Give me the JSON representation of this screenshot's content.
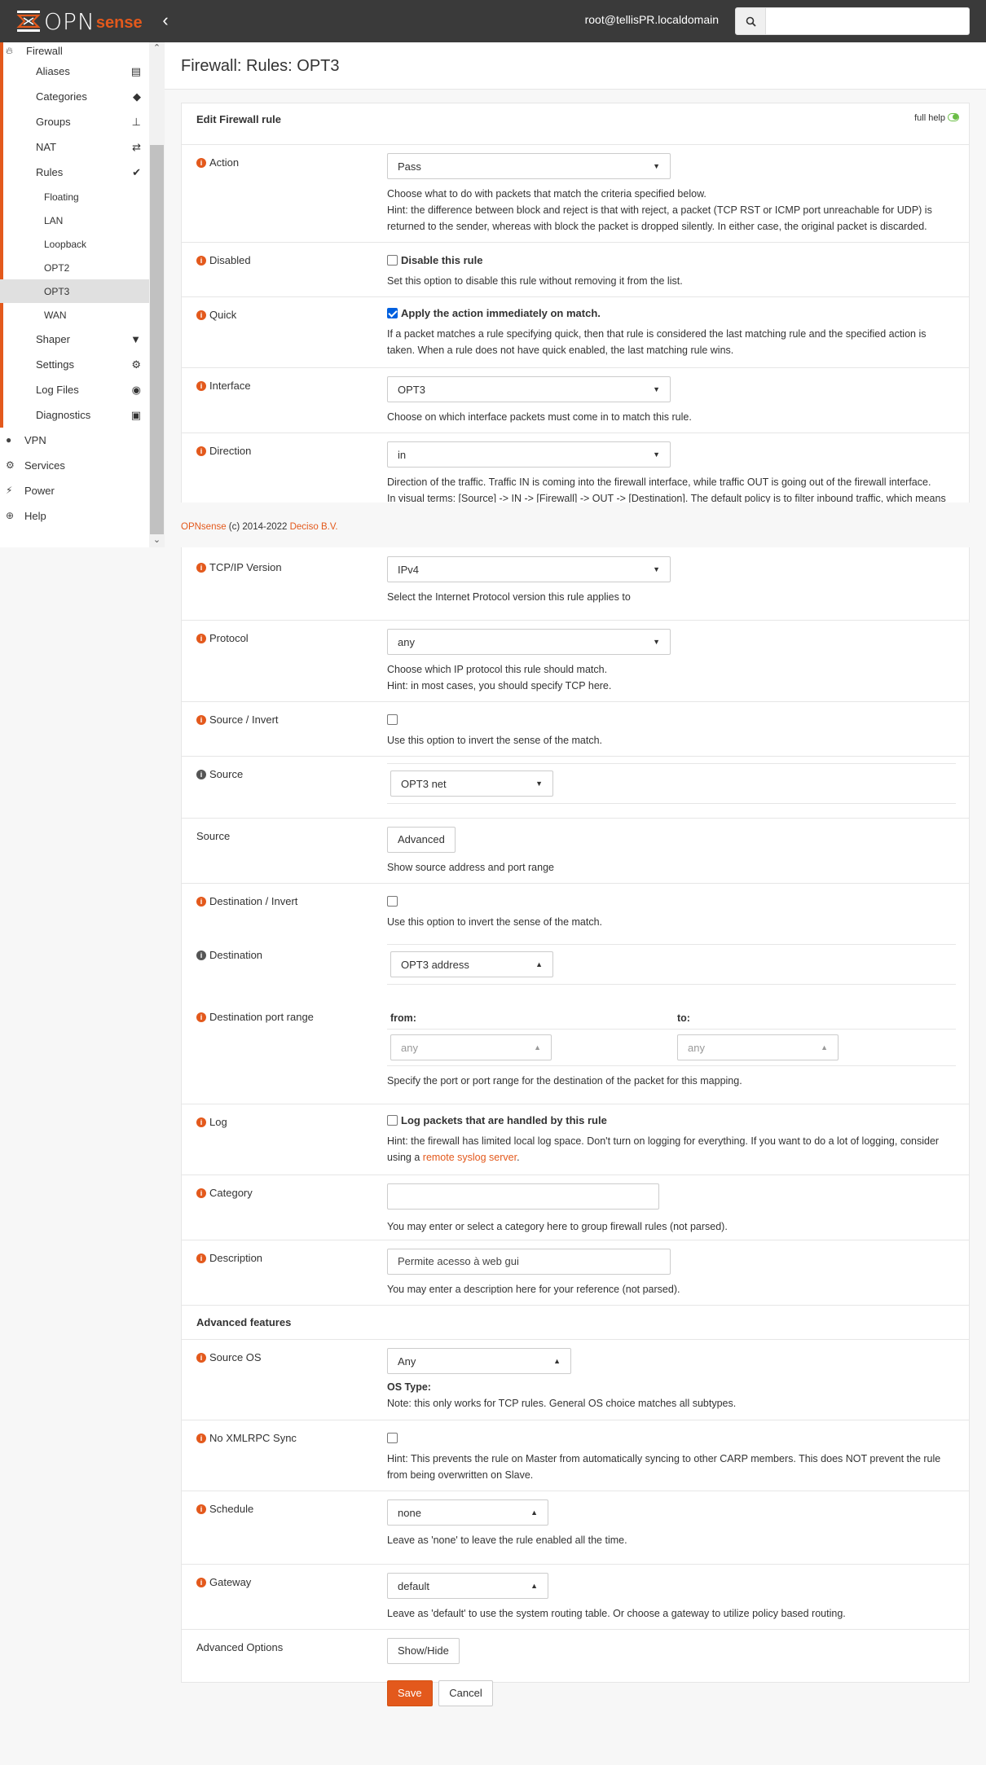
{
  "header": {
    "logo_text": "OPN",
    "logo_accent": "sense",
    "user": "root@tellisPR.localdomain",
    "search_placeholder": ""
  },
  "sidebar": {
    "firewall": "Firewall",
    "aliases": "Aliases",
    "categories": "Categories",
    "groups": "Groups",
    "nat": "NAT",
    "rules": "Rules",
    "rule_floating": "Floating",
    "rule_lan": "LAN",
    "rule_loopback": "Loopback",
    "rule_opt2": "OPT2",
    "rule_opt3": "OPT3",
    "rule_wan": "WAN",
    "shaper": "Shaper",
    "settings": "Settings",
    "log_files": "Log Files",
    "diagnostics": "Diagnostics",
    "vpn": "VPN",
    "services": "Services",
    "power": "Power",
    "help": "Help"
  },
  "page": {
    "title": "Firewall: Rules: OPT3",
    "panel_title": "Edit Firewall rule",
    "full_help": "full help"
  },
  "form": {
    "action": {
      "label": "Action",
      "value": "Pass",
      "help1": "Choose what to do with packets that match the criteria specified below.",
      "help2": "Hint: the difference between block and reject is that with reject, a packet (TCP RST or ICMP port unreachable for UDP) is returned to the sender, whereas with block the packet is dropped silently. In either case, the original packet is discarded."
    },
    "disabled": {
      "label": "Disabled",
      "check_label": "Disable this rule",
      "help": "Set this option to disable this rule without removing it from the list."
    },
    "quick": {
      "label": "Quick",
      "check_label": "Apply the action immediately on match.",
      "help": "If a packet matches a rule specifying quick, then that rule is considered the last matching rule and the specified action is taken. When a rule does not have quick enabled, the last matching rule wins."
    },
    "interface": {
      "label": "Interface",
      "value": "OPT3",
      "help": "Choose on which interface packets must come in to match this rule."
    },
    "direction": {
      "label": "Direction",
      "value": "in",
      "help1": "Direction of the traffic. Traffic IN is coming into the firewall interface, while traffic OUT is going out of the firewall interface.",
      "help2": "In visual terms: [Source] -> IN -> [Firewall] -> OUT -> [Destination]. The default policy is to filter inbound traffic, which means"
    },
    "ipversion": {
      "label": "TCP/IP Version",
      "value": "IPv4",
      "help": "Select the Internet Protocol version this rule applies to"
    },
    "protocol": {
      "label": "Protocol",
      "value": "any",
      "help1": "Choose which IP protocol this rule should match.",
      "help2": "Hint: in most cases, you should specify TCP here."
    },
    "source_invert": {
      "label": "Source / Invert",
      "help": "Use this option to invert the sense of the match."
    },
    "source": {
      "label": "Source",
      "value": "OPT3 net"
    },
    "source_adv": {
      "label": "Source",
      "button": "Advanced",
      "help": "Show source address and port range"
    },
    "dest_invert": {
      "label": "Destination / Invert",
      "help": "Use this option to invert the sense of the match."
    },
    "destination": {
      "label": "Destination",
      "value": "OPT3 address"
    },
    "dest_port": {
      "label": "Destination port range",
      "from_label": "from:",
      "to_label": "to:",
      "from_value": "any",
      "to_value": "any",
      "help": "Specify the port or port range for the destination of the packet for this mapping."
    },
    "log": {
      "label": "Log",
      "check_label": "Log packets that are handled by this rule",
      "help1": "Hint: the firewall has limited local log space. Don't turn on logging for everything. If you want to do a lot of logging, consider using a ",
      "help_link": "remote syslog server",
      "help2": "."
    },
    "category": {
      "label": "Category",
      "value": "",
      "help": "You may enter or select a category here to group firewall rules (not parsed)."
    },
    "description": {
      "label": "Description",
      "value": "Permite acesso à web gui",
      "help": "You may enter a description here for your reference (not parsed)."
    },
    "advanced_features": "Advanced features",
    "source_os": {
      "label": "Source OS",
      "value": "Any",
      "help_title": "OS Type:",
      "help": "Note: this only works for TCP rules. General OS choice matches all subtypes."
    },
    "xmlrpc": {
      "label": "No XMLRPC Sync",
      "help": "Hint: This prevents the rule on Master from automatically syncing to other CARP members. This does NOT prevent the rule from being overwritten on Slave."
    },
    "schedule": {
      "label": "Schedule",
      "value": "none",
      "help": "Leave as 'none' to leave the rule enabled all the time."
    },
    "gateway": {
      "label": "Gateway",
      "value": "default",
      "help": "Leave as 'default' to use the system routing table. Or choose a gateway to utilize policy based routing."
    },
    "advanced_options": {
      "label": "Advanced Options",
      "button": "Show/Hide"
    },
    "save": "Save",
    "cancel": "Cancel"
  },
  "footer": {
    "brand": "OPNsense",
    "copyright": " (c) 2014-2022 ",
    "company": "Deciso B.V."
  },
  "colors": {
    "accent": "#e3591c",
    "topbar": "#3a3a3a"
  }
}
